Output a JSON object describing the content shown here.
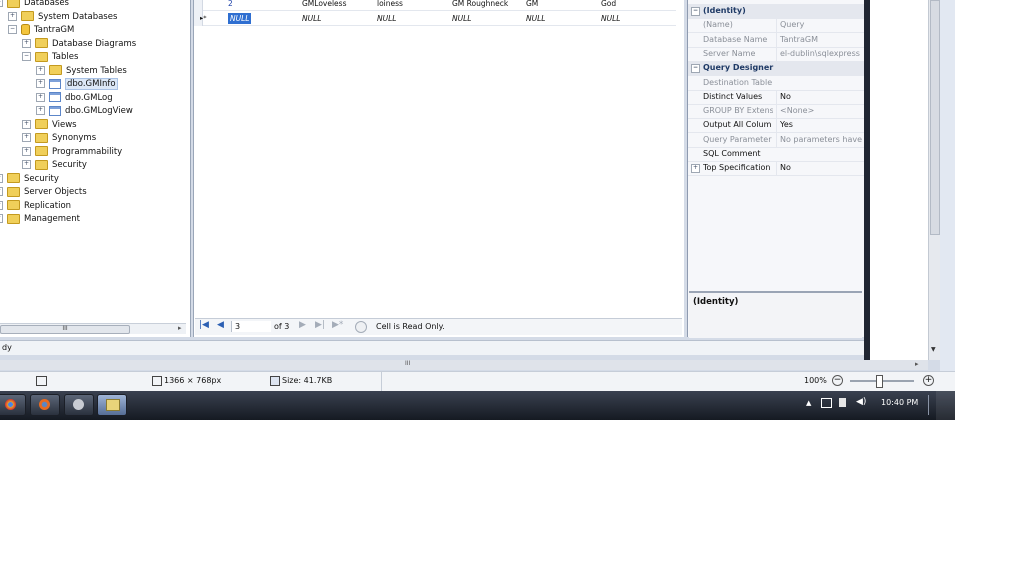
{
  "object_explorer": {
    "nodes": [
      {
        "label": "Databases",
        "toggle": "−",
        "icon": "folder-icon"
      },
      {
        "label": "System Databases",
        "toggle": "+",
        "icon": "folder-icon"
      },
      {
        "label": "TantraGM",
        "toggle": "−",
        "icon": "database-icon"
      },
      {
        "label": "Database Diagrams",
        "toggle": "+",
        "icon": "folder-icon"
      },
      {
        "label": "Tables",
        "toggle": "−",
        "icon": "folder-icon"
      },
      {
        "label": "System Tables",
        "toggle": "+",
        "icon": "folder-icon"
      },
      {
        "label": "dbo.GMInfo",
        "toggle": "+",
        "icon": "table-icon",
        "selected": true
      },
      {
        "label": "dbo.GMLog",
        "toggle": "+",
        "icon": "table-icon"
      },
      {
        "label": "dbo.GMLogView",
        "toggle": "+",
        "icon": "table-icon"
      },
      {
        "label": "Views",
        "toggle": "+",
        "icon": "folder-icon"
      },
      {
        "label": "Synonyms",
        "toggle": "+",
        "icon": "folder-icon"
      },
      {
        "label": "Programmability",
        "toggle": "+",
        "icon": "folder-icon"
      },
      {
        "label": "Security",
        "toggle": "+",
        "icon": "folder-icon"
      },
      {
        "label": "Security",
        "toggle": "+",
        "icon": "folder-icon"
      },
      {
        "label": "Server Objects",
        "toggle": "+",
        "icon": "folder-icon"
      },
      {
        "label": "Replication",
        "toggle": "+",
        "icon": "folder-icon"
      },
      {
        "label": "Management",
        "toggle": "+",
        "icon": "folder-icon"
      }
    ],
    "scroll_thumb_text": "III",
    "status_text": "dy"
  },
  "grid": {
    "row1": [
      "2",
      "GMLoveless",
      "loiness",
      "GM Roughneck",
      "GM",
      "God"
    ],
    "row_new_marker": "▸*",
    "row2": [
      "NULL",
      "NULL",
      "NULL",
      "NULL",
      "NULL",
      "NULL"
    ],
    "nav": {
      "current": "3",
      "of": "of 3",
      "message": "Cell is Read Only."
    }
  },
  "properties": {
    "rows": [
      {
        "type": "cat",
        "name": "(Identity)",
        "toggle": "−"
      },
      {
        "type": "prop",
        "name": "(Name)",
        "value": "Query",
        "dim": true
      },
      {
        "type": "prop",
        "name": "Database Name",
        "value": "TantraGM",
        "dim": true
      },
      {
        "type": "prop",
        "name": "Server Name",
        "value": "el-dublin\\sqlexpress",
        "dim": true
      },
      {
        "type": "cat",
        "name": "Query Designer",
        "toggle": "−"
      },
      {
        "type": "prop",
        "name": "Destination Table",
        "value": "",
        "dim": true
      },
      {
        "type": "prop",
        "name": "Distinct Values",
        "value": "No",
        "dim": false
      },
      {
        "type": "prop",
        "name": "GROUP BY Extens",
        "value": "<None>",
        "dim": true
      },
      {
        "type": "prop",
        "name": "Output All Colum",
        "value": "Yes",
        "dim": false
      },
      {
        "type": "prop",
        "name": "Query Parameter",
        "value": "No parameters have b",
        "dim": true
      },
      {
        "type": "prop",
        "name": "SQL Comment",
        "value": "",
        "dim": false
      },
      {
        "type": "toggleprop",
        "name": "Top Specification",
        "value": "No",
        "toggle": "+",
        "dim": false
      }
    ],
    "description_title": "(Identity)"
  },
  "viewer": {
    "dimensions": "1366 × 768px",
    "size": "Size: 41.7KB",
    "zoom": "100%",
    "zoom_fraction": 0.45
  },
  "taskbar": {
    "clock": "10:40 PM"
  }
}
